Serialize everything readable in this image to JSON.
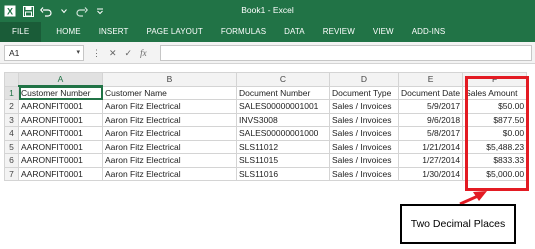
{
  "window": {
    "title": "Book1 - Excel"
  },
  "ribbon": {
    "tabs": [
      "FILE",
      "HOME",
      "INSERT",
      "PAGE LAYOUT",
      "FORMULAS",
      "DATA",
      "REVIEW",
      "VIEW",
      "ADD-INS"
    ]
  },
  "formula_bar": {
    "name_box": "A1",
    "cancel_glyph": "✕",
    "enter_glyph": "✓",
    "fx_label": "fx",
    "formula_value": ""
  },
  "sheet": {
    "columns": [
      "A",
      "B",
      "C",
      "D",
      "E",
      "F"
    ],
    "rows": [
      {
        "n": "1",
        "cells": [
          "Customer Number",
          "Customer Name",
          "Document Number",
          "Document Type",
          "Document Date",
          "Sales Amount"
        ]
      },
      {
        "n": "2",
        "cells": [
          "AARONFIT0001",
          "Aaron Fitz Electrical",
          "SALES00000001001",
          "Sales / Invoices",
          "5/9/2017",
          "$50.00"
        ]
      },
      {
        "n": "3",
        "cells": [
          "AARONFIT0001",
          "Aaron Fitz Electrical",
          "INVS3008",
          "Sales / Invoices",
          "9/6/2018",
          "$877.50"
        ]
      },
      {
        "n": "4",
        "cells": [
          "AARONFIT0001",
          "Aaron Fitz Electrical",
          "SALES00000001000",
          "Sales / Invoices",
          "5/8/2017",
          "$0.00"
        ]
      },
      {
        "n": "5",
        "cells": [
          "AARONFIT0001",
          "Aaron Fitz Electrical",
          "SLS11012",
          "Sales / Invoices",
          "1/21/2014",
          "$5,488.23"
        ]
      },
      {
        "n": "6",
        "cells": [
          "AARONFIT0001",
          "Aaron Fitz Electrical",
          "SLS11015",
          "Sales / Invoices",
          "1/27/2014",
          "$833.33"
        ]
      },
      {
        "n": "7",
        "cells": [
          "AARONFIT0001",
          "Aaron Fitz Electrical",
          "SLS11016",
          "Sales / Invoices",
          "1/30/2014",
          "$5,000.00"
        ]
      }
    ]
  },
  "annotation": {
    "callout_text": "Two Decimal Places",
    "highlight_color": "#e31b23"
  },
  "colors": {
    "excel_green": "#217346"
  }
}
